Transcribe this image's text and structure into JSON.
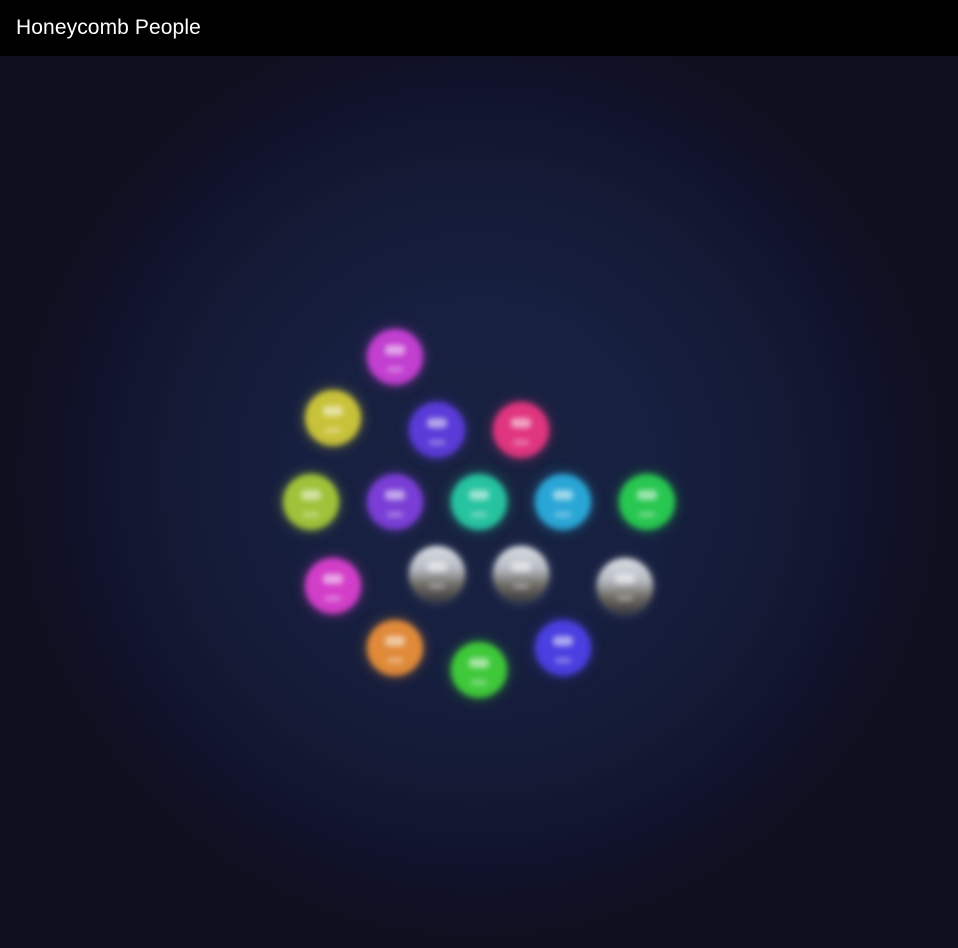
{
  "window": {
    "title": "Honeycomb People"
  },
  "people": [
    {
      "id": "p1",
      "color": "#c23fd0",
      "photo": false
    },
    {
      "id": "p2",
      "color": "#c8c23a",
      "photo": false
    },
    {
      "id": "p3",
      "color": "#5a3bd8",
      "photo": false
    },
    {
      "id": "p4",
      "color": "#e0357f",
      "photo": false
    },
    {
      "id": "p5",
      "color": "#9fc23a",
      "photo": false
    },
    {
      "id": "p6",
      "color": "#7a3ed6",
      "photo": false
    },
    {
      "id": "p7",
      "color": "#27c3a0",
      "photo": false
    },
    {
      "id": "p8",
      "color": "#2aa6d6",
      "photo": false
    },
    {
      "id": "p9",
      "color": "#28c751",
      "photo": false
    },
    {
      "id": "p10",
      "color": "#d23ec8",
      "photo": false
    },
    {
      "id": "p11",
      "color": "#b0b3b8",
      "photo": true
    },
    {
      "id": "p12",
      "color": "#c9d6e2",
      "photo": true
    },
    {
      "id": "p13",
      "color": "#c6c3c0",
      "photo": true
    },
    {
      "id": "p14",
      "color": "#e08a3a",
      "photo": false
    },
    {
      "id": "p15",
      "color": "#3fc83a",
      "photo": false
    },
    {
      "id": "p16",
      "color": "#4a3fe0",
      "photo": false
    }
  ]
}
